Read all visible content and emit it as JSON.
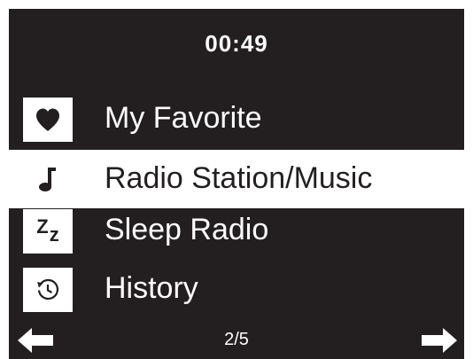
{
  "status": {
    "time": "00:49"
  },
  "menu": {
    "items": [
      {
        "label": "My Favorite",
        "icon": "heart-icon"
      },
      {
        "label": "Radio Station/Music",
        "icon": "music-note-icon",
        "selected": true
      },
      {
        "label": "Sleep Radio",
        "icon": "sleep-zz-icon",
        "glyph_big": "Z",
        "glyph_small": "z"
      },
      {
        "label": "History",
        "icon": "history-clock-icon"
      }
    ]
  },
  "footer": {
    "page": "2/5",
    "left_icon": "arrow-left-icon",
    "right_icon": "arrow-right-icon"
  },
  "colors": {
    "background": "#231f20",
    "foreground": "#ffffff",
    "highlight": "#ffffff"
  }
}
